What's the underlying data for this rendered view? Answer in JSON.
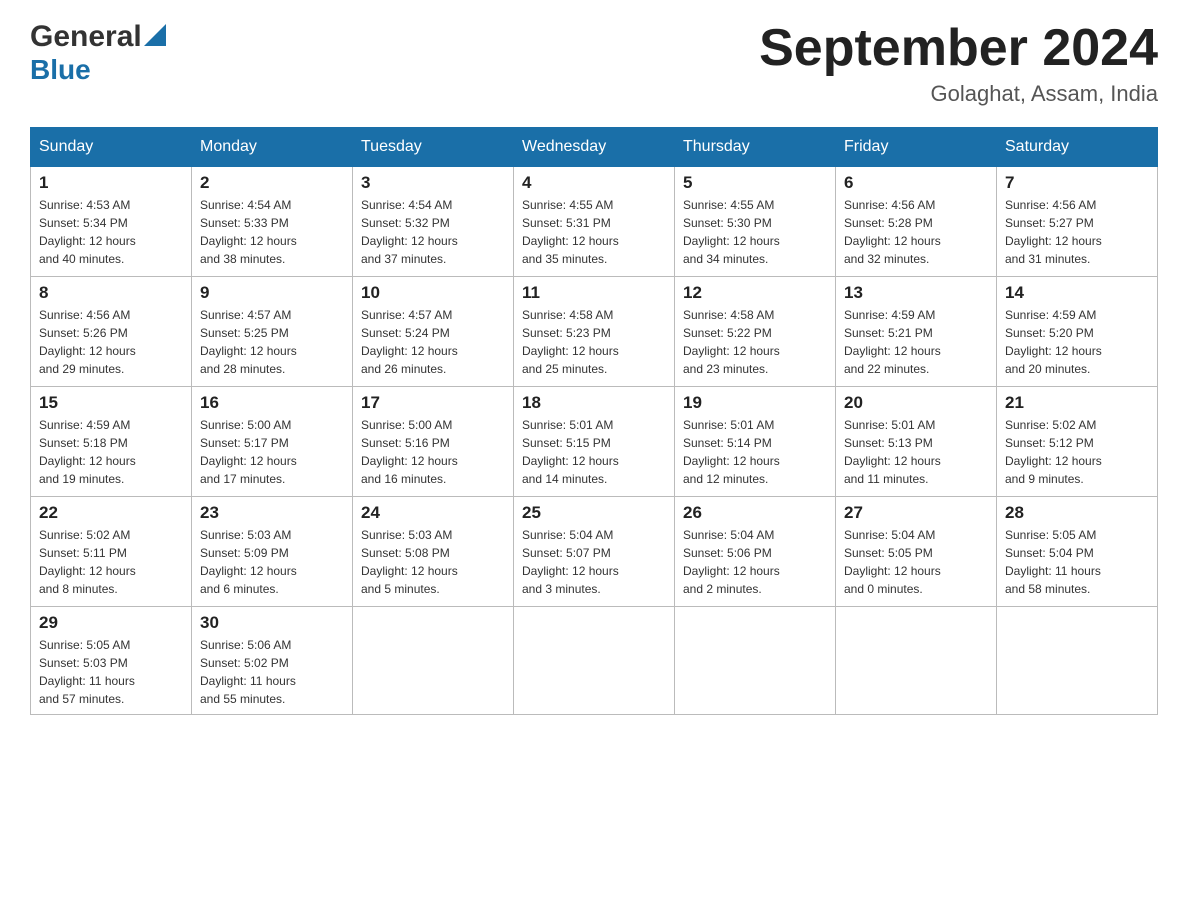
{
  "header": {
    "logo_general": "General",
    "logo_blue": "Blue",
    "month_title": "September 2024",
    "location": "Golaghat, Assam, India"
  },
  "columns": [
    "Sunday",
    "Monday",
    "Tuesday",
    "Wednesday",
    "Thursday",
    "Friday",
    "Saturday"
  ],
  "weeks": [
    [
      {
        "day": "1",
        "sunrise": "4:53 AM",
        "sunset": "5:34 PM",
        "daylight": "12 hours and 40 minutes."
      },
      {
        "day": "2",
        "sunrise": "4:54 AM",
        "sunset": "5:33 PM",
        "daylight": "12 hours and 38 minutes."
      },
      {
        "day": "3",
        "sunrise": "4:54 AM",
        "sunset": "5:32 PM",
        "daylight": "12 hours and 37 minutes."
      },
      {
        "day": "4",
        "sunrise": "4:55 AM",
        "sunset": "5:31 PM",
        "daylight": "12 hours and 35 minutes."
      },
      {
        "day": "5",
        "sunrise": "4:55 AM",
        "sunset": "5:30 PM",
        "daylight": "12 hours and 34 minutes."
      },
      {
        "day": "6",
        "sunrise": "4:56 AM",
        "sunset": "5:28 PM",
        "daylight": "12 hours and 32 minutes."
      },
      {
        "day": "7",
        "sunrise": "4:56 AM",
        "sunset": "5:27 PM",
        "daylight": "12 hours and 31 minutes."
      }
    ],
    [
      {
        "day": "8",
        "sunrise": "4:56 AM",
        "sunset": "5:26 PM",
        "daylight": "12 hours and 29 minutes."
      },
      {
        "day": "9",
        "sunrise": "4:57 AM",
        "sunset": "5:25 PM",
        "daylight": "12 hours and 28 minutes."
      },
      {
        "day": "10",
        "sunrise": "4:57 AM",
        "sunset": "5:24 PM",
        "daylight": "12 hours and 26 minutes."
      },
      {
        "day": "11",
        "sunrise": "4:58 AM",
        "sunset": "5:23 PM",
        "daylight": "12 hours and 25 minutes."
      },
      {
        "day": "12",
        "sunrise": "4:58 AM",
        "sunset": "5:22 PM",
        "daylight": "12 hours and 23 minutes."
      },
      {
        "day": "13",
        "sunrise": "4:59 AM",
        "sunset": "5:21 PM",
        "daylight": "12 hours and 22 minutes."
      },
      {
        "day": "14",
        "sunrise": "4:59 AM",
        "sunset": "5:20 PM",
        "daylight": "12 hours and 20 minutes."
      }
    ],
    [
      {
        "day": "15",
        "sunrise": "4:59 AM",
        "sunset": "5:18 PM",
        "daylight": "12 hours and 19 minutes."
      },
      {
        "day": "16",
        "sunrise": "5:00 AM",
        "sunset": "5:17 PM",
        "daylight": "12 hours and 17 minutes."
      },
      {
        "day": "17",
        "sunrise": "5:00 AM",
        "sunset": "5:16 PM",
        "daylight": "12 hours and 16 minutes."
      },
      {
        "day": "18",
        "sunrise": "5:01 AM",
        "sunset": "5:15 PM",
        "daylight": "12 hours and 14 minutes."
      },
      {
        "day": "19",
        "sunrise": "5:01 AM",
        "sunset": "5:14 PM",
        "daylight": "12 hours and 12 minutes."
      },
      {
        "day": "20",
        "sunrise": "5:01 AM",
        "sunset": "5:13 PM",
        "daylight": "12 hours and 11 minutes."
      },
      {
        "day": "21",
        "sunrise": "5:02 AM",
        "sunset": "5:12 PM",
        "daylight": "12 hours and 9 minutes."
      }
    ],
    [
      {
        "day": "22",
        "sunrise": "5:02 AM",
        "sunset": "5:11 PM",
        "daylight": "12 hours and 8 minutes."
      },
      {
        "day": "23",
        "sunrise": "5:03 AM",
        "sunset": "5:09 PM",
        "daylight": "12 hours and 6 minutes."
      },
      {
        "day": "24",
        "sunrise": "5:03 AM",
        "sunset": "5:08 PM",
        "daylight": "12 hours and 5 minutes."
      },
      {
        "day": "25",
        "sunrise": "5:04 AM",
        "sunset": "5:07 PM",
        "daylight": "12 hours and 3 minutes."
      },
      {
        "day": "26",
        "sunrise": "5:04 AM",
        "sunset": "5:06 PM",
        "daylight": "12 hours and 2 minutes."
      },
      {
        "day": "27",
        "sunrise": "5:04 AM",
        "sunset": "5:05 PM",
        "daylight": "12 hours and 0 minutes."
      },
      {
        "day": "28",
        "sunrise": "5:05 AM",
        "sunset": "5:04 PM",
        "daylight": "11 hours and 58 minutes."
      }
    ],
    [
      {
        "day": "29",
        "sunrise": "5:05 AM",
        "sunset": "5:03 PM",
        "daylight": "11 hours and 57 minutes."
      },
      {
        "day": "30",
        "sunrise": "5:06 AM",
        "sunset": "5:02 PM",
        "daylight": "11 hours and 55 minutes."
      },
      null,
      null,
      null,
      null,
      null
    ]
  ],
  "labels": {
    "sunrise": "Sunrise:",
    "sunset": "Sunset:",
    "daylight": "Daylight:"
  }
}
